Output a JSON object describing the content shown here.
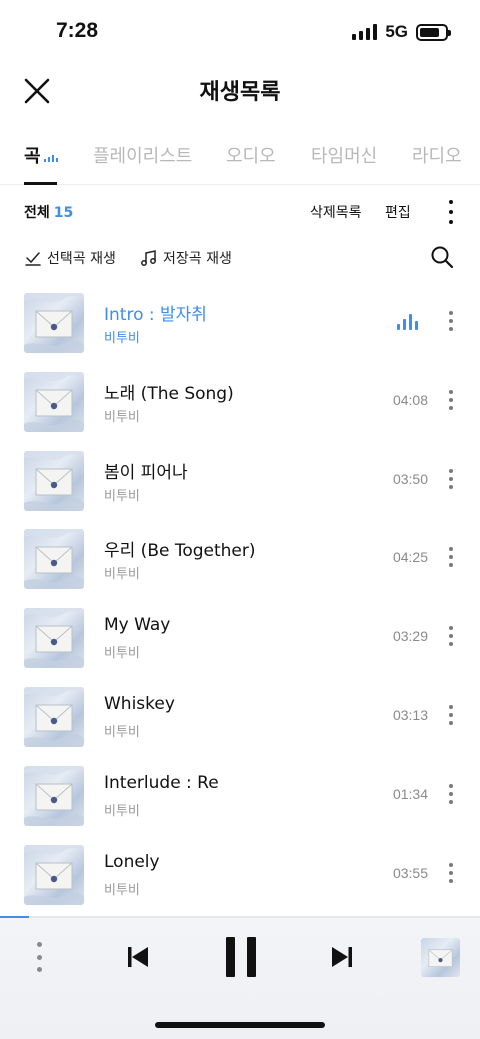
{
  "status_bar": {
    "time": "7:28",
    "network": "5G"
  },
  "header": {
    "title": "재생목록",
    "close_icon": "close-icon"
  },
  "tabs": [
    {
      "label": "곡",
      "active": true
    },
    {
      "label": "플레이리스트",
      "active": false
    },
    {
      "label": "오디오",
      "active": false
    },
    {
      "label": "타임머신",
      "active": false
    },
    {
      "label": "라디오",
      "active": false
    }
  ],
  "toolbar": {
    "total_label": "전체",
    "total_count": "15",
    "delete_list_label": "삭제목록",
    "edit_label": "편집"
  },
  "actions": {
    "play_selected_label": "선택곡 재생",
    "play_saved_label": "저장곡 재생"
  },
  "songs": [
    {
      "title": "Intro : 발자취",
      "artist": "비투비",
      "duration": "",
      "playing": true
    },
    {
      "title": "노래 (The Song)",
      "artist": "비투비",
      "duration": "04:08",
      "playing": false
    },
    {
      "title": "봄이 피어나",
      "artist": "비투비",
      "duration": "03:50",
      "playing": false
    },
    {
      "title": "우리 (Be Together)",
      "artist": "비투비",
      "duration": "04:25",
      "playing": false
    },
    {
      "title": "My Way",
      "artist": "비투비",
      "duration": "03:29",
      "playing": false
    },
    {
      "title": "Whiskey",
      "artist": "비투비",
      "duration": "03:13",
      "playing": false
    },
    {
      "title": "Interlude : Re",
      "artist": "비투비",
      "duration": "01:34",
      "playing": false
    },
    {
      "title": "Lonely",
      "artist": "비투비",
      "duration": "03:55",
      "playing": false
    }
  ],
  "player": {
    "progress": 0.06,
    "state": "playing"
  },
  "colors": {
    "accent": "#3d8ef0",
    "text": "#111111",
    "muted": "#9a9a9a",
    "player_bg": "#f2f4f7"
  }
}
